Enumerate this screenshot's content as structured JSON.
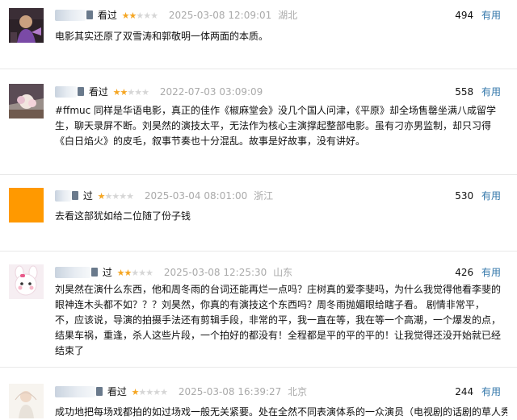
{
  "comments": [
    {
      "status": "看过",
      "rating": 2,
      "time": "2025-03-08 12:09:01",
      "location": "湖北",
      "votes": "494",
      "vote_label": "有用",
      "text": "电影其实还原了双雪涛和郭敬明一体两面的本质。"
    },
    {
      "status": "看过",
      "rating": 2,
      "time": "2022-07-03 03:09:09",
      "location": "",
      "votes": "558",
      "vote_label": "有用",
      "text": "#ffmuc 同样是华语电影，真正的佳作《椒麻堂会》没几个国人问津，《平原》却全场售罄坐满八成留学生，聊天录屏不断。刘昊然的演技太平，无法作为核心主演撑起整部电影。虽有刁亦男监制，却只习得《白日焰火》的皮毛，叙事节奏也十分混乱。故事是好故事，没有讲好。"
    },
    {
      "status": "过",
      "rating": 1,
      "time": "2025-03-04 08:01:00",
      "location": "浙江",
      "votes": "530",
      "vote_label": "有用",
      "text": "去看这部犹如给二位随了份子钱"
    },
    {
      "status": "过",
      "rating": 2,
      "time": "2025-03-08 12:25:30",
      "location": "山东",
      "votes": "426",
      "vote_label": "有用",
      "text": "刘昊然在演什么东西，他和周冬雨的台词还能再烂一点吗？庄树真的爱李斐吗，为什么我觉得他看李斐的眼神连木头都不如？？？刘昊然，你真的有演技这个东西吗？周冬雨抛媚眼给瞎子看。 剧情非常平，不，应该说，导演的拍摄手法还有剪辑手段，非常的平，我一直在等，我在等一个高潮，一个爆发的点，结果车祸，重逢，杀人这些片段，一个拍好的都没有！全程都是平的平的平的！让我觉得还没开始就已经结束了"
    },
    {
      "status": "看过",
      "rating": 1,
      "time": "2025-03-08 16:39:27",
      "location": "北京",
      "votes": "244",
      "vote_label": "有用",
      "text": "成功地把每场戏都拍的如过场戏一般无关紧要。处在全然不同表演体系的一众演员（电视剧的话剧的草人秀"
    }
  ],
  "colors": {
    "star_on": "#f5a623",
    "star_off": "#d6d6d6",
    "link": "#3377aa",
    "meta_gray": "#aaaaaa"
  }
}
